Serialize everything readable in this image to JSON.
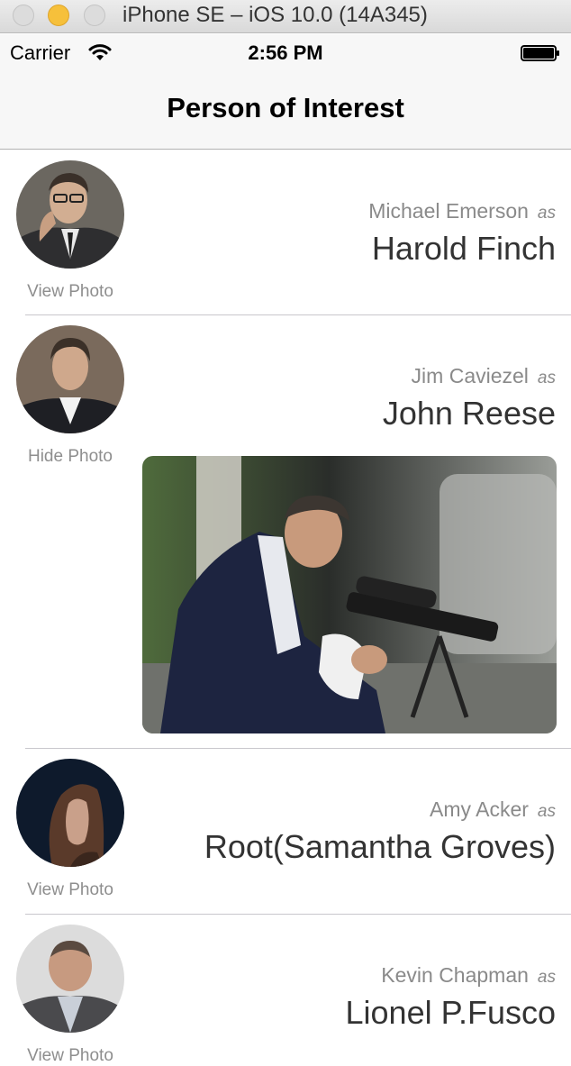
{
  "simulator": {
    "title": "iPhone SE – iOS 10.0 (14A345)"
  },
  "status_bar": {
    "carrier": "Carrier",
    "time": "2:56 PM"
  },
  "nav": {
    "title": "Person of Interest"
  },
  "rows": [
    {
      "actor": "Michael Emerson",
      "as": "as",
      "character": "Harold Finch",
      "toggle": "View Photo"
    },
    {
      "actor": "Jim Caviezel",
      "as": "as",
      "character": "John Reese",
      "toggle": "Hide Photo"
    },
    {
      "actor": "Amy Acker",
      "as": "as",
      "character": "Root(Samantha Groves)",
      "toggle": "View Photo"
    },
    {
      "actor": "Kevin Chapman",
      "as": "as",
      "character": "Lionel P.Fusco",
      "toggle": "View Photo"
    }
  ],
  "colors": {
    "accent_window": "#f6c03b",
    "secondary_text": "#8a8a8a",
    "primary_text": "#333333"
  }
}
